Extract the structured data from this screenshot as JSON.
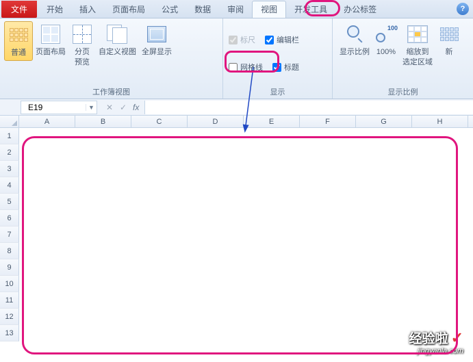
{
  "menu": {
    "file": "文件",
    "items": [
      "开始",
      "插入",
      "页面布局",
      "公式",
      "数据",
      "审阅",
      "视图",
      "开发工具",
      "办公标签"
    ],
    "active_index": 6
  },
  "ribbon": {
    "groups": {
      "views": {
        "label": "工作簿视图",
        "normal": "普通",
        "page_layout": "页面布局",
        "page_break": "分页\n预览",
        "custom": "自定义视图",
        "fullscreen": "全屏显示"
      },
      "show": {
        "label": "显示",
        "ruler": "标尺",
        "formula_bar": "编辑栏",
        "gridlines": "网格线",
        "headings": "标题",
        "ruler_checked": true,
        "formula_bar_checked": true,
        "gridlines_checked": false,
        "headings_checked": true
      },
      "zoom": {
        "label": "显示比例",
        "zoom": "显示比例",
        "hundred": "100%",
        "to_selection": "缩放到\n选定区域"
      }
    }
  },
  "formula_bar": {
    "name_box": "E19",
    "fx": "fx"
  },
  "sheet": {
    "columns": [
      "A",
      "B",
      "C",
      "D",
      "E",
      "F",
      "G",
      "H"
    ],
    "rows": [
      1,
      2,
      3,
      4,
      5,
      6,
      7,
      8,
      9,
      10,
      11,
      12,
      13
    ]
  },
  "watermark": {
    "text": "经验啦",
    "url": "jingyanla.com"
  }
}
